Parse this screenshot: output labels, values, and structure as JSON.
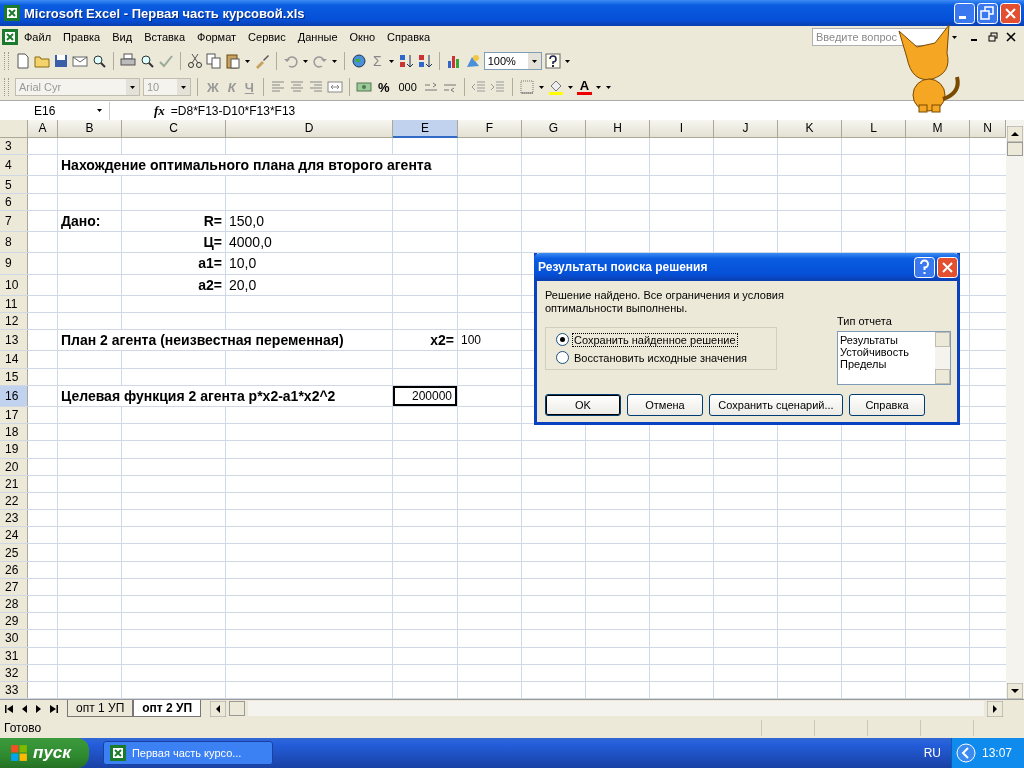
{
  "window": {
    "title": "Microsoft Excel - Первая часть курсовой.xls"
  },
  "menu": [
    {
      "label": "Файл"
    },
    {
      "label": "Правка"
    },
    {
      "label": "Вид"
    },
    {
      "label": "Вставка"
    },
    {
      "label": "Формат"
    },
    {
      "label": "Сервис"
    },
    {
      "label": "Данные"
    },
    {
      "label": "Окно"
    },
    {
      "label": "Справка"
    }
  ],
  "help_search": {
    "placeholder": "Введите вопрос"
  },
  "standard_toolbar": {
    "sum": "Σ",
    "zoom": "100%"
  },
  "formatting_toolbar": {
    "disabled": true,
    "font": "Arial Cyr",
    "size": "10",
    "bold": "Ж",
    "italic": "К",
    "underline": "Ч",
    "percent": "%",
    "thousands": "000",
    "font_color": "A"
  },
  "formula_bar": {
    "name_box": "E16",
    "function_label": "fx",
    "formula": "=D8*F13-D10*F13*F13"
  },
  "columns": [
    {
      "label": "A",
      "selected": false
    },
    {
      "label": "B",
      "selected": false
    },
    {
      "label": "C",
      "selected": false
    },
    {
      "label": "D",
      "selected": false
    },
    {
      "label": "E",
      "selected": true
    },
    {
      "label": "F",
      "selected": false
    },
    {
      "label": "G",
      "selected": false
    },
    {
      "label": "H",
      "selected": false
    },
    {
      "label": "I",
      "selected": false
    },
    {
      "label": "J",
      "selected": false
    },
    {
      "label": "K",
      "selected": false
    },
    {
      "label": "L",
      "selected": false
    },
    {
      "label": "M",
      "selected": false
    },
    {
      "label": "N",
      "selected": false
    }
  ],
  "rows": [
    {
      "label": "3",
      "selected": false
    },
    {
      "label": "4",
      "selected": false,
      "cells": {
        "B": {
          "text": "Нахождение оптимального плана для второго агента",
          "kind": "heading",
          "selected": false
        }
      }
    },
    {
      "label": "5",
      "selected": false
    },
    {
      "label": "6",
      "selected": false
    },
    {
      "label": "7",
      "selected": false,
      "cells": {
        "B": {
          "text": "Дано:",
          "kind": "heading",
          "selected": false
        },
        "C": {
          "text": "R=",
          "kind": "label",
          "selected": false
        },
        "D": {
          "text": "150,0",
          "kind": "value",
          "selected": false
        }
      }
    },
    {
      "label": "8",
      "selected": false,
      "cells": {
        "C": {
          "text": "Ц=",
          "kind": "label",
          "selected": false
        },
        "D": {
          "text": "4000,0",
          "kind": "value",
          "selected": false
        }
      }
    },
    {
      "label": "9",
      "selected": false,
      "cells": {
        "C": {
          "text": "a1=",
          "kind": "label",
          "selected": false
        },
        "D": {
          "text": "10,0",
          "kind": "value",
          "selected": false
        }
      }
    },
    {
      "label": "10",
      "selected": false,
      "cells": {
        "C": {
          "text": "a2=",
          "kind": "label",
          "selected": false
        },
        "D": {
          "text": "20,0",
          "kind": "value",
          "selected": false
        }
      }
    },
    {
      "label": "11",
      "selected": false
    },
    {
      "label": "12",
      "selected": false
    },
    {
      "label": "13",
      "selected": false,
      "cells": {
        "B": {
          "text": "План 2 агента (неизвестная переменная)",
          "kind": "heading",
          "selected": false
        },
        "E": {
          "text": "x2=",
          "kind": "label",
          "selected": false
        },
        "F": {
          "text": "100",
          "kind": "small",
          "selected": false
        }
      }
    },
    {
      "label": "14",
      "selected": false
    },
    {
      "label": "15",
      "selected": false
    },
    {
      "label": "16",
      "selected": true,
      "cells": {
        "B": {
          "text": "Целевая функция 2 агента p*x2-a1*x2^2",
          "kind": "heading",
          "selected": false
        },
        "E": {
          "text": "200000",
          "kind": "number",
          "selected": true
        }
      }
    },
    {
      "label": "17",
      "selected": false
    },
    {
      "label": "18",
      "selected": false
    },
    {
      "label": "19",
      "selected": false
    },
    {
      "label": "20",
      "selected": false
    },
    {
      "label": "21",
      "selected": false
    },
    {
      "label": "22",
      "selected": false
    },
    {
      "label": "23",
      "selected": false
    },
    {
      "label": "24",
      "selected": false
    },
    {
      "label": "25",
      "selected": false
    },
    {
      "label": "26",
      "selected": false
    },
    {
      "label": "27",
      "selected": false
    },
    {
      "label": "28",
      "selected": false
    },
    {
      "label": "29",
      "selected": false
    },
    {
      "label": "30",
      "selected": false
    },
    {
      "label": "31",
      "selected": false
    },
    {
      "label": "32",
      "selected": false
    },
    {
      "label": "33",
      "selected": false
    }
  ],
  "dialog": {
    "title": "Результаты поиска решения",
    "message": "Решение найдено. Все ограничения и условия оптимальности выполнены.",
    "options": [
      {
        "label": "Сохранить найденное решение",
        "selected": true
      },
      {
        "label": "Восстановить исходные значения",
        "selected": false
      }
    ],
    "report_label": "Тип отчета",
    "report_types": [
      {
        "label": "Результаты",
        "selected": false
      },
      {
        "label": "Устойчивость",
        "selected": false
      },
      {
        "label": "Пределы",
        "selected": false
      }
    ],
    "buttons": [
      {
        "label": "OK",
        "default": true
      },
      {
        "label": "Отмена",
        "default": false
      },
      {
        "label": "Сохранить сценарий...",
        "default": false
      },
      {
        "label": "Справка",
        "default": false
      }
    ]
  },
  "sheet_tabs": [
    {
      "label": "опт 1 УП",
      "selected": false
    },
    {
      "label": "опт 2 УП",
      "selected": true
    }
  ],
  "status_bar": {
    "text": "Готово"
  },
  "taskbar": {
    "start": "пуск",
    "tasks": [
      {
        "label": "Первая часть курсо...",
        "selected": false
      }
    ],
    "language": "RU",
    "clock": "13:07"
  }
}
